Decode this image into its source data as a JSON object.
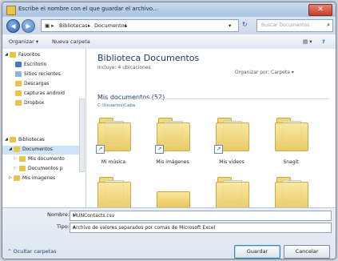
{
  "window": {
    "title": "Escribe el nombre con el que guardar el archivo..."
  },
  "nav": {
    "breadcrumb": [
      "Bibliotecas",
      "Documentos"
    ],
    "search_placeholder": "Buscar Documentos"
  },
  "toolbar": {
    "organize": "Organizar ▾",
    "new_folder": "Nueva carpeta"
  },
  "sidebar": {
    "items": [
      {
        "label": "Favoritos",
        "icon": "star-icon"
      },
      {
        "label": "Escritorio",
        "icon": "desktop-icon"
      },
      {
        "label": "Sitios recientes",
        "icon": "recent-icon"
      },
      {
        "label": "Descargas",
        "icon": "download-icon"
      },
      {
        "label": "capturas android",
        "icon": "folder-icon"
      },
      {
        "label": "Dropbox",
        "icon": "dropbox-icon"
      },
      {
        "label": "Bibliotecas",
        "icon": "library-icon"
      },
      {
        "label": "Documentos",
        "icon": "documents-icon"
      },
      {
        "label": "Mis documento",
        "icon": "folder-icon"
      },
      {
        "label": "Documentos p",
        "icon": "folder-icon"
      },
      {
        "label": "Mis imagenes",
        "icon": "pictures-icon"
      }
    ]
  },
  "library": {
    "title": "Biblioteca Documentos",
    "includes": "Incluye: 4 ubicaciones",
    "arrange": "Organizar por:  Carpeta ▾",
    "section": "Mis documentos (52)",
    "path": "C:\\Usuarios\\Caba"
  },
  "folders": [
    {
      "label": "Mi música"
    },
    {
      "label": "Mis imágenes"
    },
    {
      "label": "Mis videos"
    },
    {
      "label": "Snagit"
    }
  ],
  "file": {
    "name_label": "Nombre:",
    "name_value": "MUNContacts.csv",
    "type_label": "Tipo:",
    "type_value": "Archivo de valores separados por comas de Microsoft Excel"
  },
  "actions": {
    "hide_folders": "Ocultar carpetas",
    "save": "Guardar",
    "cancel": "Cancelar"
  }
}
